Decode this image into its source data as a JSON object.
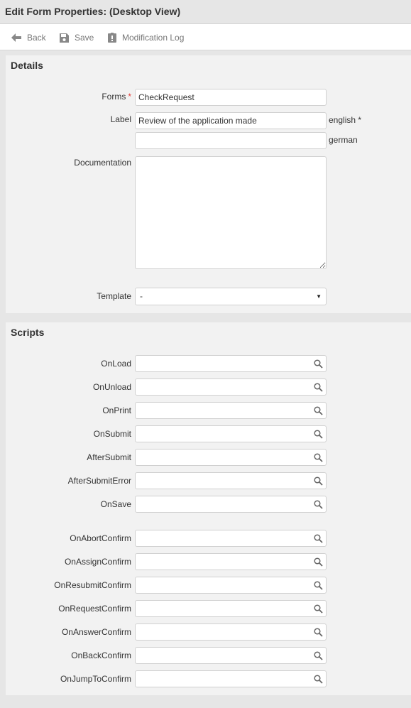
{
  "window": {
    "title": "Edit Form Properties:  (Desktop View)"
  },
  "toolbar": {
    "back": "Back",
    "save": "Save",
    "log": "Modification Log"
  },
  "details": {
    "title": "Details",
    "forms_label": "Forms",
    "required_mark": "*",
    "forms_value": "CheckRequest",
    "label_label": "Label",
    "label_en_value": "Review of the application made",
    "lang_en": "english *",
    "label_de_value": "",
    "lang_de": "german",
    "doc_label": "Documentation",
    "doc_value": "",
    "template_label": "Template",
    "template_value": "-"
  },
  "scripts": {
    "title": "Scripts",
    "items": [
      {
        "label": "OnLoad",
        "value": ""
      },
      {
        "label": "OnUnload",
        "value": ""
      },
      {
        "label": "OnPrint",
        "value": ""
      },
      {
        "label": "OnSubmit",
        "value": ""
      },
      {
        "label": "AfterSubmit",
        "value": ""
      },
      {
        "label": "AfterSubmitError",
        "value": ""
      },
      {
        "label": "OnSave",
        "value": ""
      },
      {
        "label": "OnAbortConfirm",
        "value": ""
      },
      {
        "label": "OnAssignConfirm",
        "value": ""
      },
      {
        "label": "OnResubmitConfirm",
        "value": ""
      },
      {
        "label": "OnRequestConfirm",
        "value": ""
      },
      {
        "label": "OnAnswerConfirm",
        "value": ""
      },
      {
        "label": "OnBackConfirm",
        "value": ""
      },
      {
        "label": "OnJumpToConfirm",
        "value": ""
      }
    ]
  },
  "icons": {
    "back": "arrow-left-icon",
    "save": "floppy-disk-icon",
    "log": "clipboard-icon",
    "search": "search-icon",
    "dropdown": "caret-down-icon"
  },
  "colors": {
    "required": "#e53935",
    "panel": "#f2f2f2",
    "toolbar": "#ffffff"
  }
}
